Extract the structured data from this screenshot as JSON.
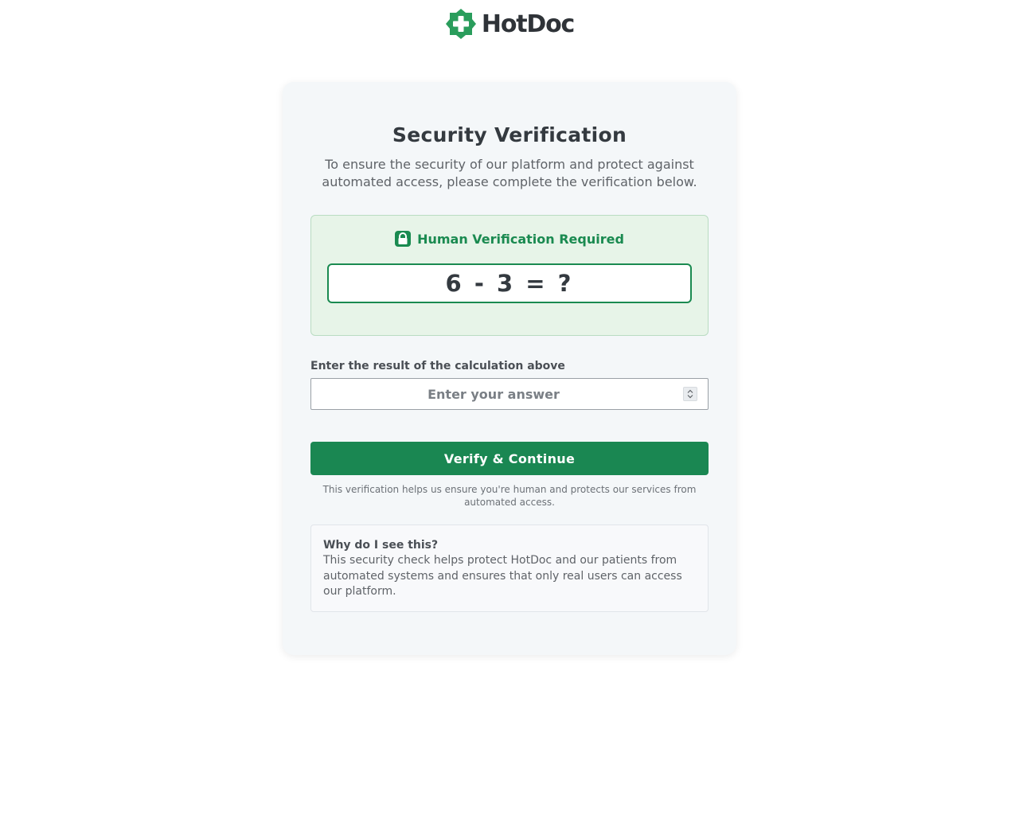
{
  "brand": {
    "name": "HotDoc",
    "logo_icon": "medical-cross-icon",
    "accent_color": "#2a9d5c"
  },
  "card": {
    "title": "Security Verification",
    "subtitle": "To ensure the security of our platform and protect against automated access, please complete the verification below."
  },
  "verification": {
    "heading": "Human Verification Required",
    "heading_icon": "lock-icon",
    "equation": "6 - 3 = ?",
    "accent_color": "#1a8a50"
  },
  "answer": {
    "label": "Enter the result of the calculation above",
    "placeholder": "Enter your answer",
    "value": ""
  },
  "actions": {
    "submit_label": "Verify & Continue",
    "submit_color": "#1a8752"
  },
  "note": "This verification helps us ensure you're human and protects our services from automated access.",
  "why": {
    "title": "Why do I see this?",
    "text": "This security check helps protect HotDoc and our patients from automated systems and ensures that only real users can access our platform."
  }
}
